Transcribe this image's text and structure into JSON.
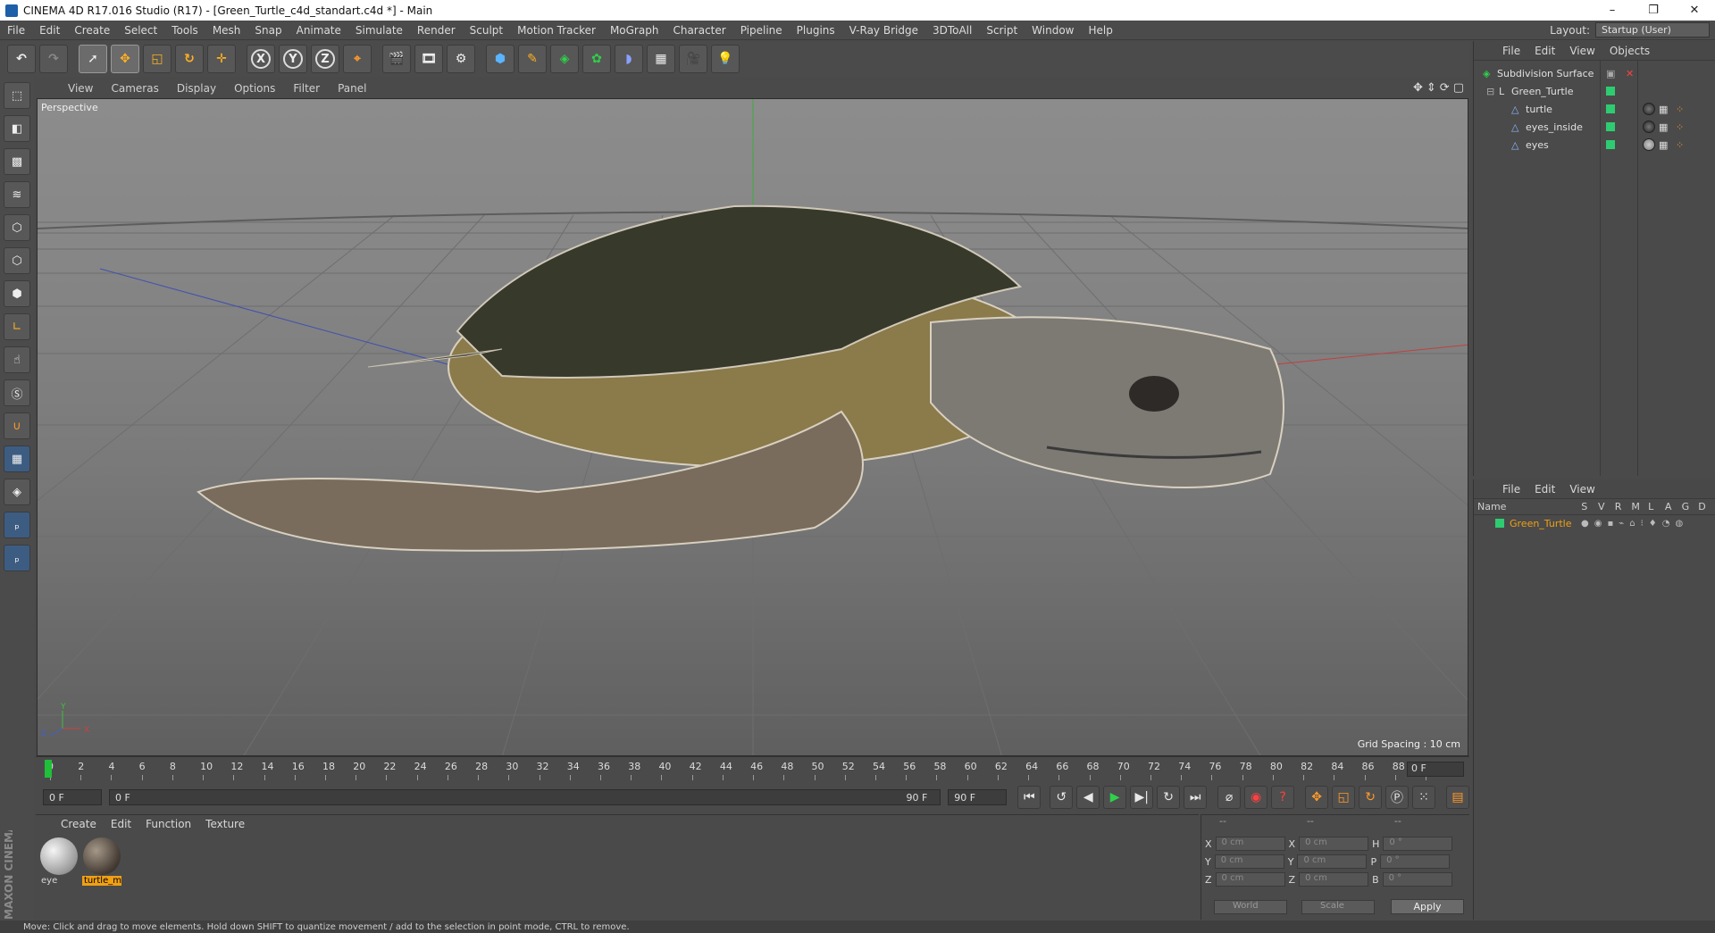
{
  "window": {
    "title": "CINEMA 4D R17.016 Studio (R17) - [Green_Turtle_c4d_standart.c4d *] - Main",
    "controls": [
      "–",
      "❐",
      "✕"
    ]
  },
  "menubar": {
    "items": [
      "File",
      "Edit",
      "Create",
      "Select",
      "Tools",
      "Mesh",
      "Snap",
      "Animate",
      "Simulate",
      "Render",
      "Sculpt",
      "Motion Tracker",
      "MoGraph",
      "Character",
      "Pipeline",
      "Plugins",
      "V-Ray Bridge",
      "3DToAll",
      "Script",
      "Window",
      "Help"
    ],
    "layout_label": "Layout:",
    "layout_value": "Startup (User)"
  },
  "toolbar": {
    "axis_x": "X",
    "axis_y": "Y",
    "axis_z": "Z"
  },
  "viewport": {
    "menu": [
      "View",
      "Cameras",
      "Display",
      "Options",
      "Filter",
      "Panel"
    ],
    "camera_label": "Perspective",
    "grid_spacing": "Grid Spacing : 10 cm",
    "axis_labels": {
      "x": "X",
      "y": "Y",
      "z": "Z"
    }
  },
  "timeline": {
    "ticks": [
      "0",
      "2",
      "4",
      "6",
      "8",
      "10",
      "12",
      "14",
      "16",
      "18",
      "20",
      "22",
      "24",
      "26",
      "28",
      "30",
      "32",
      "34",
      "36",
      "38",
      "40",
      "42",
      "44",
      "46",
      "48",
      "50",
      "52",
      "54",
      "56",
      "58",
      "60",
      "62",
      "64",
      "66",
      "68",
      "70",
      "72",
      "74",
      "76",
      "78",
      "80",
      "82",
      "84",
      "86",
      "88",
      "90"
    ],
    "end_field": "0 F",
    "current_frame": "0 F",
    "range_start": "0 F",
    "range_end": "90 F",
    "max_frame": "90 F"
  },
  "materials": {
    "menu": [
      "Create",
      "Edit",
      "Function",
      "Texture"
    ],
    "items": [
      {
        "name": "eye",
        "selected": false,
        "color": "#c8c8c8"
      },
      {
        "name": "turtle_m",
        "selected": true,
        "color": "#5a5248"
      }
    ]
  },
  "coordinates": {
    "header": [
      "--",
      "--",
      "--"
    ],
    "rows": [
      {
        "a_label": "X",
        "a_value": "0 cm",
        "b_label": "X",
        "b_value": "0 cm",
        "c_label": "H",
        "c_value": "0 °"
      },
      {
        "a_label": "Y",
        "a_value": "0 cm",
        "b_label": "Y",
        "b_value": "0 cm",
        "c_label": "P",
        "c_value": "0 °"
      },
      {
        "a_label": "Z",
        "a_value": "0 cm",
        "b_label": "Z",
        "b_value": "0 cm",
        "c_label": "B",
        "c_value": "0 °"
      }
    ],
    "mode_dropdown": "World",
    "type_dropdown": "Scale",
    "apply_label": "Apply"
  },
  "object_manager": {
    "menu": [
      "File",
      "Edit",
      "View",
      "Objects"
    ],
    "objects": [
      {
        "name": "Subdivision Surface",
        "indent": 0
      },
      {
        "name": "Green_Turtle",
        "indent": 1
      },
      {
        "name": "turtle",
        "indent": 2
      },
      {
        "name": "eyes_inside",
        "indent": 2
      },
      {
        "name": "eyes",
        "indent": 2
      }
    ]
  },
  "layer_manager": {
    "menu": [
      "File",
      "Edit",
      "View"
    ],
    "columns": [
      "Name",
      "S",
      "V",
      "R",
      "M",
      "L",
      "A",
      "G",
      "D"
    ],
    "layers": [
      {
        "name": "Green_Turtle",
        "color": "#2ecc71"
      }
    ]
  },
  "status": {
    "text": "Move: Click and drag to move elements. Hold down SHIFT to quantize movement / add to the selection in point mode, CTRL to remove."
  },
  "brand": {
    "text": "MAXON CINEMA 4D"
  },
  "colors": {
    "accent_green": "#1fbf3a",
    "selection_orange": "#f0a014",
    "layer_green": "#2ecc71"
  }
}
